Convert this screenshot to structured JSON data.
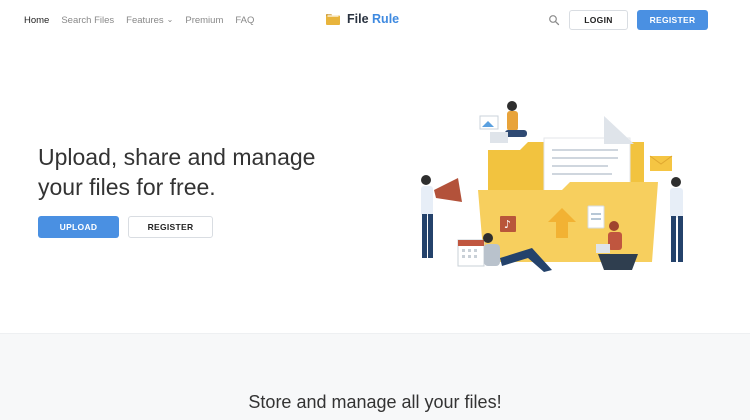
{
  "nav": {
    "links": [
      {
        "label": "Home"
      },
      {
        "label": "Search Files"
      },
      {
        "label": "Features"
      },
      {
        "label": "Premium"
      },
      {
        "label": "FAQ"
      }
    ],
    "logo": {
      "part1": "File",
      "part2": "Rule"
    },
    "login_label": "LOGIN",
    "register_label": "REGISTER"
  },
  "hero": {
    "title_line1": "Upload, share and manage",
    "title_line2": "your files for free.",
    "upload_label": "UPLOAD",
    "register_label": "REGISTER"
  },
  "section2": {
    "title": "Store and manage all your files!"
  },
  "colors": {
    "accent": "#4a90e2",
    "folder": "#f7cf5e",
    "text": "#333333"
  },
  "icons": {
    "logo": "folder-icon",
    "search": "search-icon",
    "features_dropdown": "chevron-down-icon"
  }
}
